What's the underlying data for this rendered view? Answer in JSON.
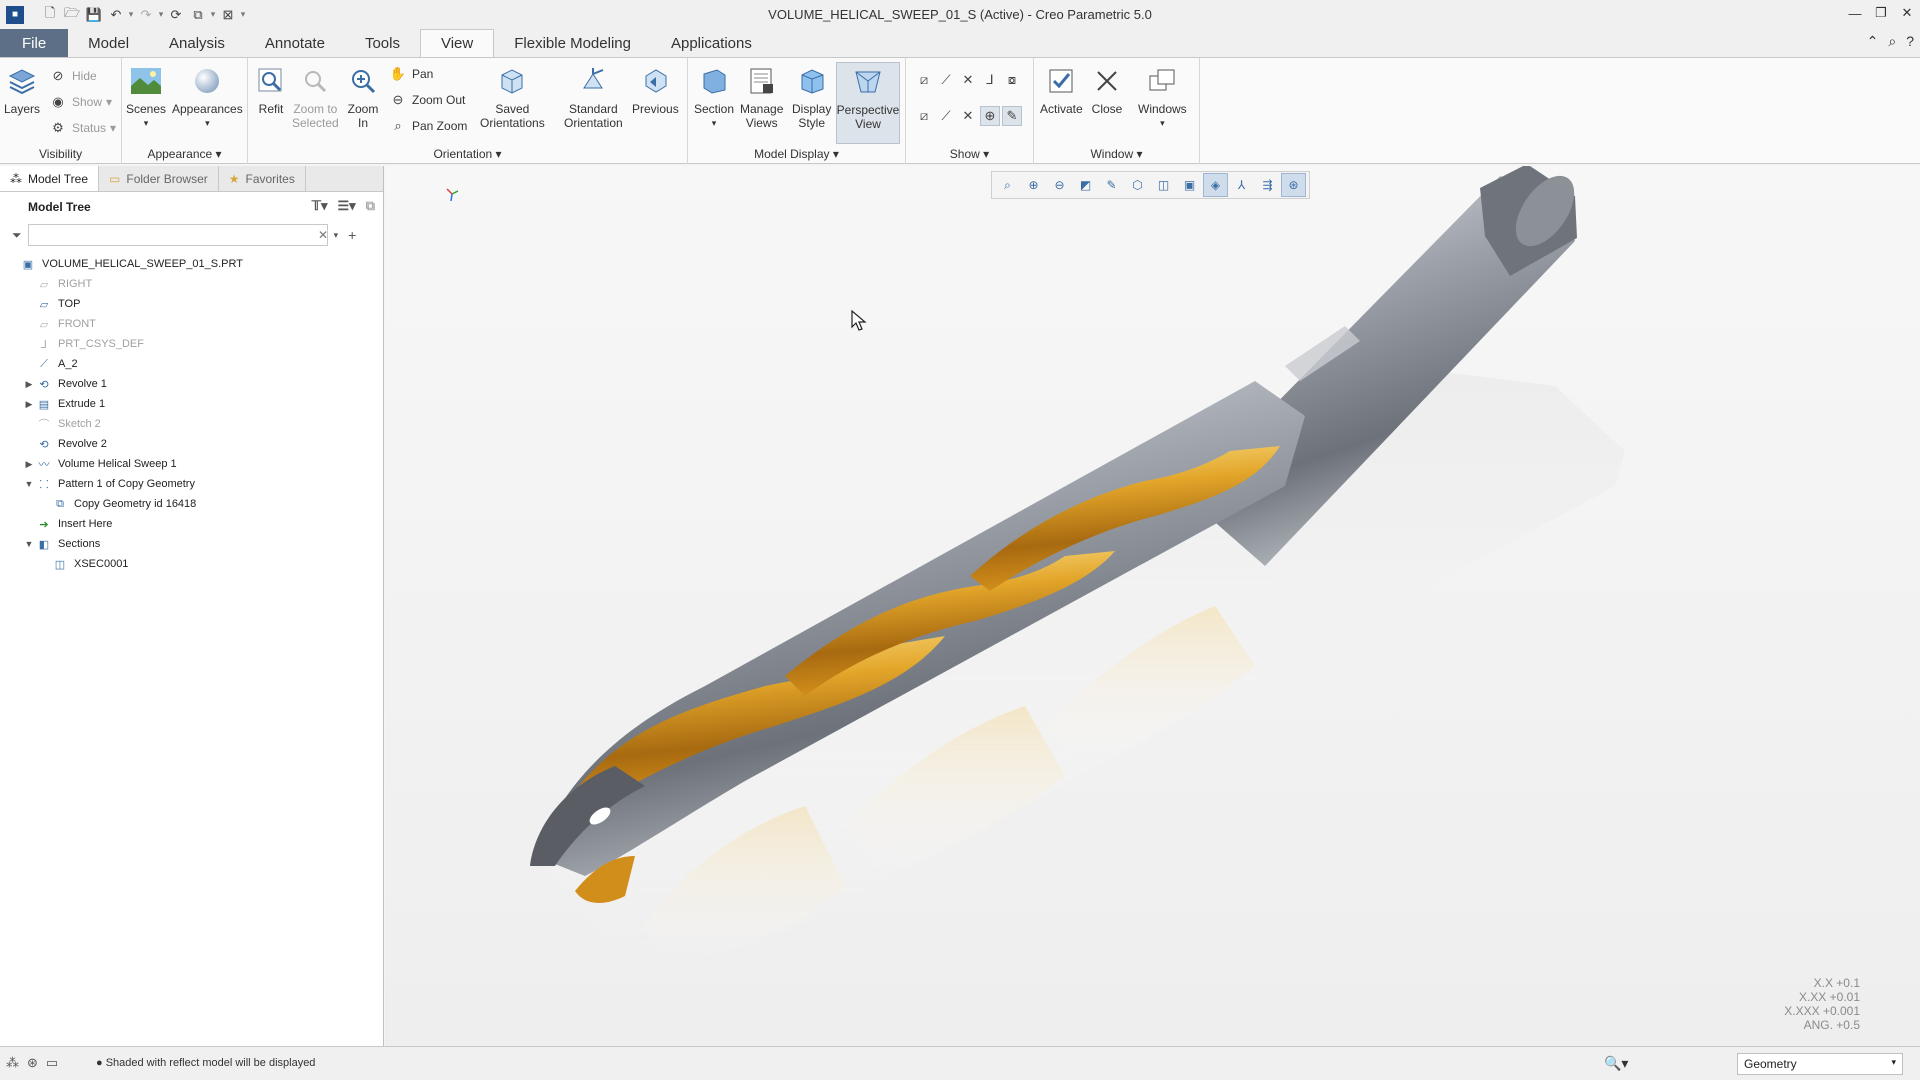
{
  "window": {
    "title": "VOLUME_HELICAL_SWEEP_01_S (Active) - Creo Parametric 5.0"
  },
  "tabs": [
    "File",
    "Model",
    "Analysis",
    "Annotate",
    "Tools",
    "View",
    "Flexible Modeling",
    "Applications"
  ],
  "ribbon": {
    "groups": {
      "visibility": "Visibility",
      "appearance": "Appearance",
      "orientation": "Orientation",
      "model_display": "Model Display",
      "show": "Show",
      "window": "Window"
    },
    "layers": "Layers",
    "hide": "Hide",
    "show": "Show",
    "status": "Status",
    "scenes": "Scenes",
    "appearances": "Appearances",
    "refit": "Refit",
    "zoom_to_selected": "Zoom to\nSelected",
    "zoom_in": "Zoom\nIn",
    "pan": "Pan",
    "zoom_out": "Zoom Out",
    "pan_zoom": "Pan Zoom",
    "saved_orientations": "Saved\nOrientations",
    "standard_orientation": "Standard\nOrientation",
    "previous": "Previous",
    "section": "Section",
    "manage_views": "Manage\nViews",
    "display_style": "Display\nStyle",
    "perspective_view": "Perspective\nView",
    "activate": "Activate",
    "close": "Close",
    "windows": "Windows"
  },
  "panel": {
    "tabs": [
      "Model Tree",
      "Folder Browser",
      "Favorites"
    ],
    "header": "Model Tree",
    "filter_value": "",
    "tree": [
      {
        "label": "VOLUME_HELICAL_SWEEP_01_S.PRT",
        "indent": 0,
        "expander": "",
        "dim": false,
        "icon": "part-icon"
      },
      {
        "label": "RIGHT",
        "indent": 1,
        "expander": "",
        "dim": true,
        "icon": "datum-plane-icon"
      },
      {
        "label": "TOP",
        "indent": 1,
        "expander": "",
        "dim": false,
        "icon": "datum-plane-icon"
      },
      {
        "label": "FRONT",
        "indent": 1,
        "expander": "",
        "dim": true,
        "icon": "datum-plane-icon"
      },
      {
        "label": "PRT_CSYS_DEF",
        "indent": 1,
        "expander": "",
        "dim": true,
        "icon": "csys-icon"
      },
      {
        "label": "A_2",
        "indent": 1,
        "expander": "",
        "dim": false,
        "icon": "axis-icon"
      },
      {
        "label": "Revolve 1",
        "indent": 1,
        "expander": "▶",
        "dim": false,
        "icon": "revolve-icon"
      },
      {
        "label": "Extrude 1",
        "indent": 1,
        "expander": "▶",
        "dim": false,
        "icon": "extrude-icon"
      },
      {
        "label": "Sketch 2",
        "indent": 1,
        "expander": "",
        "dim": true,
        "icon": "sketch-icon"
      },
      {
        "label": "Revolve 2",
        "indent": 1,
        "expander": "",
        "dim": false,
        "icon": "revolve-icon"
      },
      {
        "label": "Volume Helical Sweep 1",
        "indent": 1,
        "expander": "▶",
        "dim": false,
        "icon": "sweep-icon"
      },
      {
        "label": "Pattern 1 of Copy Geometry",
        "indent": 1,
        "expander": "▼",
        "dim": false,
        "icon": "pattern-icon"
      },
      {
        "label": "Copy Geometry id 16418",
        "indent": 2,
        "expander": "",
        "dim": false,
        "icon": "copy-geometry-icon"
      },
      {
        "label": "Insert Here",
        "indent": 1,
        "expander": "",
        "dim": false,
        "icon": "insert-arrow-icon"
      },
      {
        "label": "Sections",
        "indent": 1,
        "expander": "▼",
        "dim": false,
        "icon": "sections-icon"
      },
      {
        "label": "XSEC0001",
        "indent": 2,
        "expander": "",
        "dim": false,
        "icon": "xsec-icon"
      }
    ]
  },
  "viewport": {
    "tolerances": [
      "X.X +0.1",
      "X.XX +0.01",
      "X.XXX +0.001",
      "ANG. +0.5"
    ]
  },
  "statusbar": {
    "message": "Shaded with reflect model will be displayed",
    "selection_filter": "Geometry"
  },
  "colors": {
    "file_tab": "#5c6f87",
    "accent": "#3a6ea5",
    "drill_gold": "#d99a1e",
    "drill_steel": "#8c9098"
  }
}
